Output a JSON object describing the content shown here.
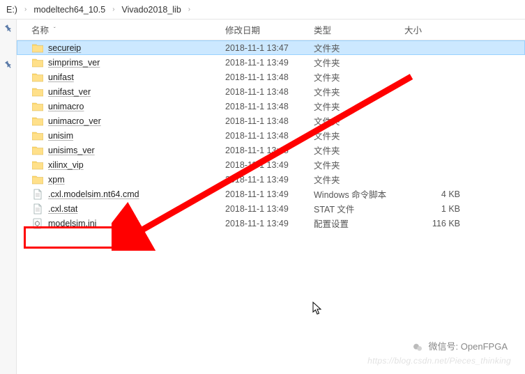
{
  "breadcrumb": {
    "root": "E:)",
    "seg1": "modeltech64_10.5",
    "seg2": "Vivado2018_lib"
  },
  "columns": {
    "name": "名称",
    "date": "修改日期",
    "type": "类型",
    "size": "大小"
  },
  "rows": [
    {
      "icon": "folder",
      "name": "secureip",
      "date": "2018-11-1 13:47",
      "type": "文件夹",
      "size": "",
      "selected": true
    },
    {
      "icon": "folder",
      "name": "simprims_ver",
      "date": "2018-11-1 13:49",
      "type": "文件夹",
      "size": "",
      "selected": false
    },
    {
      "icon": "folder",
      "name": "unifast",
      "date": "2018-11-1 13:48",
      "type": "文件夹",
      "size": "",
      "selected": false
    },
    {
      "icon": "folder",
      "name": "unifast_ver",
      "date": "2018-11-1 13:48",
      "type": "文件夹",
      "size": "",
      "selected": false
    },
    {
      "icon": "folder",
      "name": "unimacro",
      "date": "2018-11-1 13:48",
      "type": "文件夹",
      "size": "",
      "selected": false
    },
    {
      "icon": "folder",
      "name": "unimacro_ver",
      "date": "2018-11-1 13:48",
      "type": "文件夹",
      "size": "",
      "selected": false
    },
    {
      "icon": "folder",
      "name": "unisim",
      "date": "2018-11-1 13:48",
      "type": "文件夹",
      "size": "",
      "selected": false
    },
    {
      "icon": "folder",
      "name": "unisims_ver",
      "date": "2018-11-1 13:48",
      "type": "文件夹",
      "size": "",
      "selected": false
    },
    {
      "icon": "folder",
      "name": "xilinx_vip",
      "date": "2018-11-1 13:49",
      "type": "文件夹",
      "size": "",
      "selected": false
    },
    {
      "icon": "folder",
      "name": "xpm",
      "date": "2018-11-1 13:49",
      "type": "文件夹",
      "size": "",
      "selected": false
    },
    {
      "icon": "file",
      "name": ".cxl.modelsim.nt64.cmd",
      "date": "2018-11-1 13:49",
      "type": "Windows 命令脚本",
      "size": "4 KB",
      "selected": false
    },
    {
      "icon": "file",
      "name": ".cxl.stat",
      "date": "2018-11-1 13:49",
      "type": "STAT 文件",
      "size": "1 KB",
      "selected": false
    },
    {
      "icon": "ini",
      "name": "modelsim.ini",
      "date": "2018-11-1 13:49",
      "type": "配置设置",
      "size": "116 KB",
      "selected": false
    }
  ],
  "watermark": {
    "label": "微信号:",
    "value": "OpenFPGA"
  },
  "watermark2": "https://blog.csdn.net/Pieces_thinking"
}
